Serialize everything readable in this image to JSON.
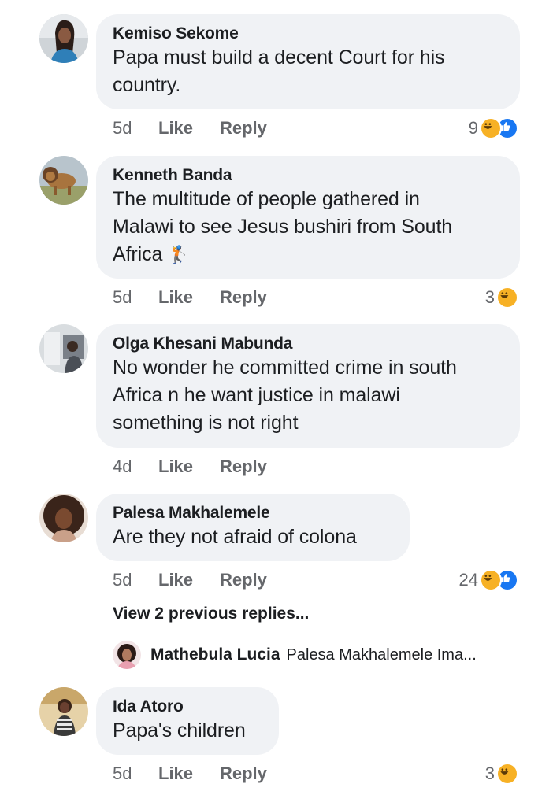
{
  "comments": [
    {
      "author": "Kemiso Sekome",
      "text": "Papa must build a decent Court for his\ncountry.",
      "age": "5d",
      "like_label": "Like",
      "reply_label": "Reply",
      "reaction_count": "9",
      "reactions": [
        "haha",
        "like"
      ]
    },
    {
      "author": "Kenneth Banda",
      "text": "The multitude of people gathered in\nMalawi to see Jesus bushiri from South\nAfrica",
      "text_emoji": "🏌",
      "age": "5d",
      "like_label": "Like",
      "reply_label": "Reply",
      "reaction_count": "3",
      "reactions": [
        "haha"
      ]
    },
    {
      "author": "Olga Khesani Mabunda",
      "text": "No wonder he committed crime in south\nAfrica n he want justice in malawi\nsomething is not right",
      "age": "4d",
      "like_label": "Like",
      "reply_label": "Reply"
    },
    {
      "author": "Palesa Makhalemele",
      "text": "Are they not afraid of colona",
      "age": "5d",
      "like_label": "Like",
      "reply_label": "Reply",
      "reaction_count": "24",
      "reactions": [
        "haha",
        "like"
      ],
      "view_replies": "View 2 previous replies...",
      "latest_reply": {
        "author": "Mathebula Lucia",
        "snippet": "Palesa Makhalemele Ima..."
      }
    },
    {
      "author": "Ida Atoro",
      "text": "Papa's children",
      "age": "5d",
      "like_label": "Like",
      "reply_label": "Reply",
      "reaction_count": "3",
      "reactions": [
        "haha"
      ]
    }
  ],
  "colors": {
    "bubble_bg": "#f0f2f5",
    "meta_text": "#65676b",
    "haha_reaction": "#f7b125",
    "like_reaction": "#1877f2"
  },
  "icons": {
    "haha": "haha-reaction-icon",
    "like": "like-reaction-icon"
  }
}
